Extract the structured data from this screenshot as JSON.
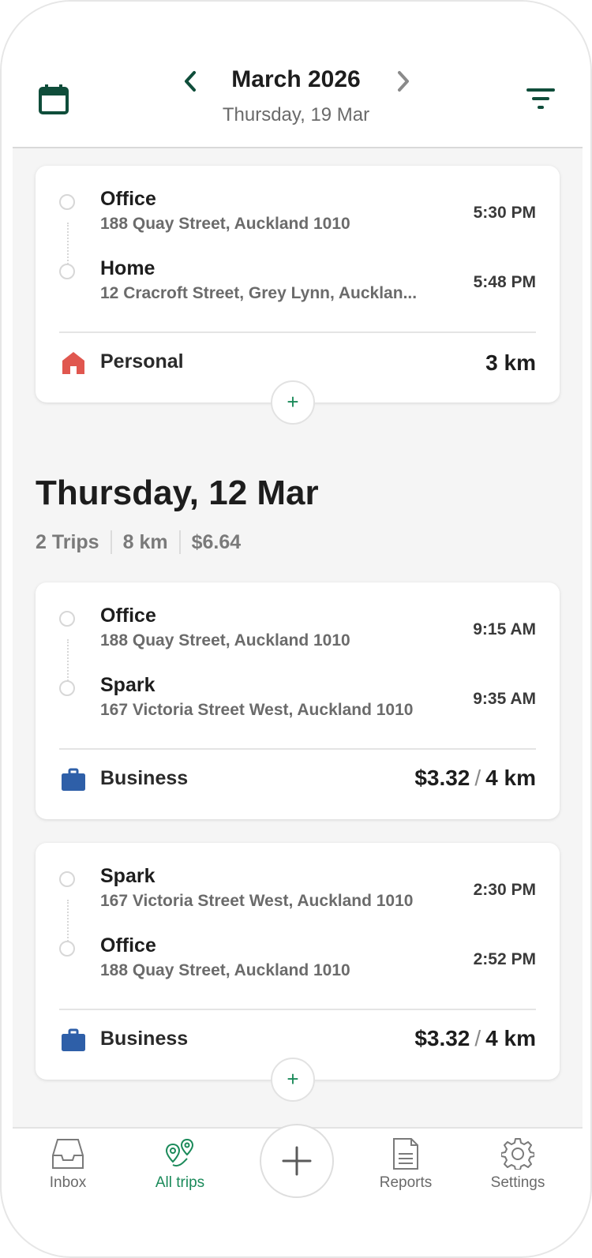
{
  "header": {
    "month": "March 2026",
    "subtitle": "Thursday, 19 Mar"
  },
  "trips_top": [
    {
      "stops": [
        {
          "name": "Office",
          "address": "188 Quay Street, Auckland 1010",
          "time": "5:30 PM"
        },
        {
          "name": "Home",
          "address": "12 Cracroft Street, Grey Lynn, Aucklan...",
          "time": "5:48 PM"
        }
      ],
      "purpose": "Personal",
      "amount": "3 km"
    }
  ],
  "section": {
    "title": "Thursday, 12 Mar",
    "trips_count": "2 Trips",
    "distance": "8 km",
    "value": "$6.64"
  },
  "trips": [
    {
      "stops": [
        {
          "name": "Office",
          "address": "188 Quay Street, Auckland 1010",
          "time": "9:15 AM"
        },
        {
          "name": "Spark",
          "address": "167 Victoria Street West, Auckland 1010",
          "time": "9:35 AM"
        }
      ],
      "purpose": "Business",
      "amount_value": "$3.32",
      "amount_sep": "/",
      "amount_distance": "4 km"
    },
    {
      "stops": [
        {
          "name": "Spark",
          "address": "167 Victoria Street West, Auckland 1010",
          "time": "2:30 PM"
        },
        {
          "name": "Office",
          "address": "188 Quay Street, Auckland 1010",
          "time": "2:52 PM"
        }
      ],
      "purpose": "Business",
      "amount_value": "$3.32",
      "amount_sep": "/",
      "amount_distance": "4 km"
    }
  ],
  "add_symbol": "+",
  "nav": {
    "inbox": "Inbox",
    "all_trips": "All trips",
    "reports": "Reports",
    "settings": "Settings"
  },
  "colors": {
    "accent": "#1b8a5a",
    "header_icon": "#0f4d3a",
    "personal": "#e0574f",
    "business": "#2e5fa8"
  }
}
